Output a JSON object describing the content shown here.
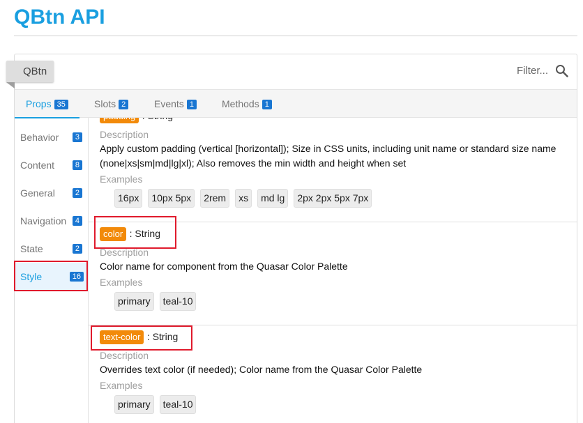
{
  "page": {
    "title": "QBtn API"
  },
  "header": {
    "component_chip": "QBtn",
    "filter_placeholder": "Filter...",
    "filter_icon": "search-icon"
  },
  "tabs": [
    {
      "label": "Props",
      "count": "35"
    },
    {
      "label": "Slots",
      "count": "2"
    },
    {
      "label": "Events",
      "count": "1"
    },
    {
      "label": "Methods",
      "count": "1"
    }
  ],
  "sidebar": [
    {
      "label": "Behavior",
      "count": "3"
    },
    {
      "label": "Content",
      "count": "8"
    },
    {
      "label": "General",
      "count": "2"
    },
    {
      "label": "Navigation",
      "count": "4"
    },
    {
      "label": "State",
      "count": "2"
    },
    {
      "label": "Style",
      "count": "16"
    }
  ],
  "props": [
    {
      "name": "padding",
      "type": ": String",
      "description_label": "Description",
      "description": "Apply custom padding (vertical [horizontal]); Size in CSS units, including unit name or standard size name (none|xs|sm|md|lg|xl); Also removes the min width and height when set",
      "examples_label": "Examples",
      "examples": [
        "16px",
        "10px 5px",
        "2rem",
        "xs",
        "md lg",
        "2px 2px 5px 7px"
      ]
    },
    {
      "name": "color",
      "type": ": String",
      "description_label": "Description",
      "description": "Color name for component from the Quasar Color Palette",
      "examples_label": "Examples",
      "examples": [
        "primary",
        "teal-10"
      ]
    },
    {
      "name": "text-color",
      "type": ": String",
      "description_label": "Description",
      "description": "Overrides text color (if needed); Color name from the Quasar Color Palette",
      "examples_label": "Examples",
      "examples": [
        "primary",
        "teal-10"
      ]
    }
  ],
  "colors": {
    "accent": "#1a9fe0",
    "badge": "#1976d2",
    "prop_name": "#f28a0a",
    "highlight": "#e01a2c"
  }
}
